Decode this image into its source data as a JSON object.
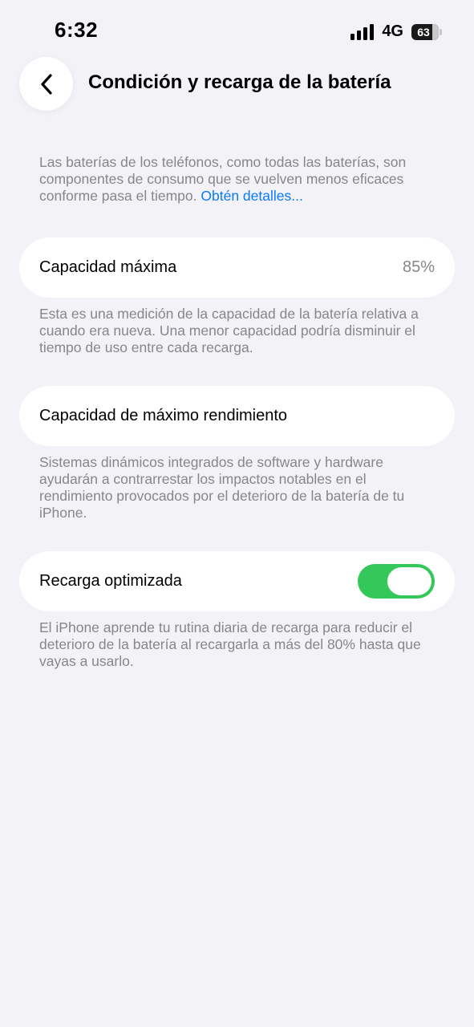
{
  "status_bar": {
    "time": "6:32",
    "network": "4G",
    "battery": "63"
  },
  "nav": {
    "back_icon": "chevron-left-icon",
    "title": "Condición y recarga de la batería"
  },
  "intro": {
    "text": "Las baterías de los teléfonos, como todas las baterías, son componentes de consumo que se vuelven menos eficaces conforme pasa el tiempo.",
    "link": "Obtén detalles..."
  },
  "max_capacity": {
    "label": "Capacidad máxima",
    "value": "85%",
    "footnote": "Esta es una medición de la capacidad de la batería relativa a cuando era nueva. Una menor capacidad podría disminuir el tiempo de uso entre cada recarga."
  },
  "peak_performance": {
    "label": "Capacidad de máximo rendimiento",
    "footnote": "Sistemas dinámicos integrados de software y hardware ayudarán a contrarrestar los impactos notables en el rendimiento provocados por el deterioro de la batería de tu iPhone."
  },
  "optimized_charging": {
    "label": "Recarga optimizada",
    "enabled": true,
    "footnote": "El iPhone aprende tu rutina diaria de recarga para reducir el deterioro de la batería al recargarla a más del 80% hasta que vayas a usarlo."
  },
  "colors": {
    "background": "#F2F2F7",
    "toggle_on": "#34C759",
    "link": "#0A7AFF",
    "secondary_text": "#86868B"
  }
}
